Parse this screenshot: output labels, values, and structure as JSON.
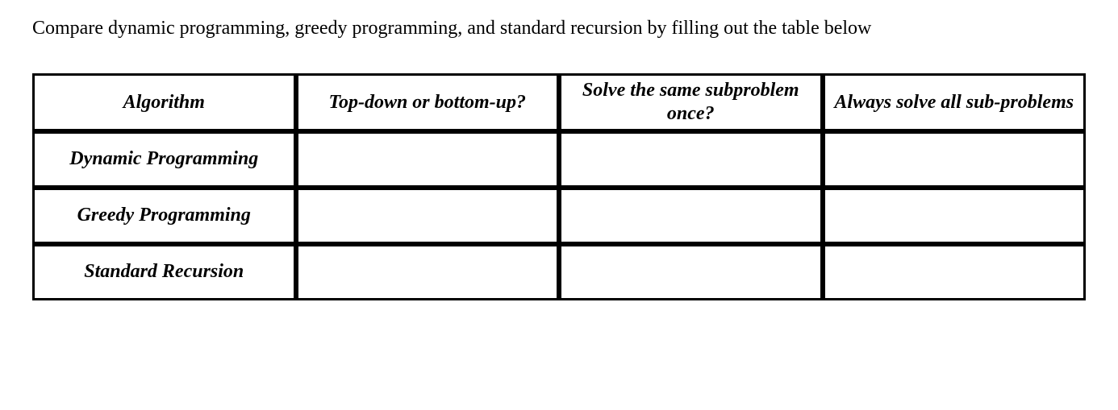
{
  "prompt": "Compare dynamic programming, greedy programming, and standard recursion by filling out the table below",
  "table": {
    "headers": [
      "Algorithm",
      "Top-down or bottom-up?",
      "Solve the same subproblem once?",
      "Always solve all sub-problems"
    ],
    "rows": [
      {
        "label": "Dynamic Programming",
        "cells": [
          "",
          "",
          ""
        ]
      },
      {
        "label": "Greedy Programming",
        "cells": [
          "",
          "",
          ""
        ]
      },
      {
        "label": "Standard Recursion",
        "cells": [
          "",
          "",
          ""
        ]
      }
    ]
  }
}
